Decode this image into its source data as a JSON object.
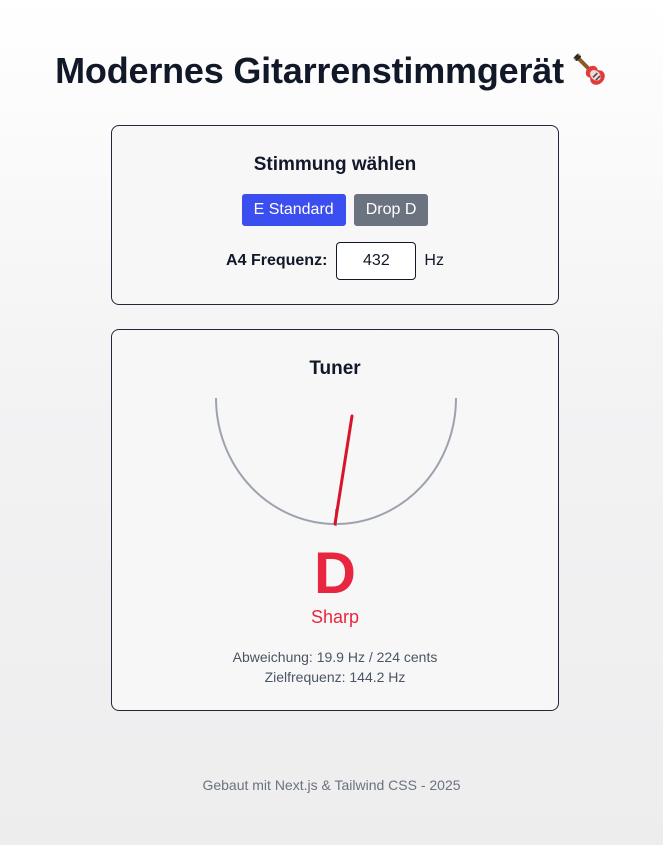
{
  "header": {
    "title": "Modernes Gitarrenstimmgerät",
    "icon": "guitar-icon"
  },
  "tuning": {
    "heading": "Stimmung wählen",
    "buttons": [
      {
        "label": "E Standard",
        "active": true
      },
      {
        "label": "Drop D",
        "active": false
      }
    ],
    "a4_label": "A4 Frequenz:",
    "a4_value": "432",
    "a4_unit": "Hz"
  },
  "tuner": {
    "heading": "Tuner",
    "note": "D",
    "status": "Sharp",
    "deviation": "Abweichung: 19.9 Hz / 224 cents",
    "target": "Zielfrequenz: 144.2 Hz",
    "needle_color": "#d9132a",
    "arc_color": "#9ca3af"
  },
  "footer": {
    "text": "Gebaut mit Next.js & Tailwind CSS - 2025"
  },
  "colors": {
    "accent": "#3b4ef0",
    "secondary": "#6b7280",
    "alert": "#e8263f"
  }
}
